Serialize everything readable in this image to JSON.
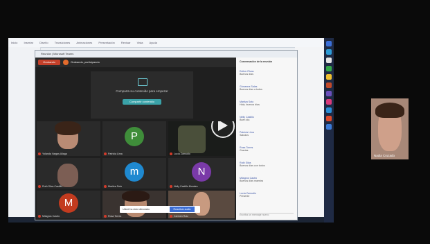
{
  "screen": {
    "browser_tabs": [
      "Inicio",
      "Insertar",
      "Diseño",
      "Transiciones",
      "Animaciones",
      "Presentación",
      "Revisar",
      "Vista",
      "Ayuda"
    ],
    "window_title": "Reunión | Microsoft Teams"
  },
  "meeting": {
    "record_button": "Grabando",
    "record_status": "Grabando, participando",
    "share_prompt": "Comparta su contenido para empezar",
    "share_button": "Compartir contenido",
    "participants": [
      {
        "name": "Yolanda Vargas Aliaga",
        "type": "video"
      },
      {
        "name": "Patricia Lima",
        "type": "avatar",
        "initial": "P",
        "color": "#3f8d3a"
      },
      {
        "name": "Lucía Zamudio",
        "type": "video"
      },
      {
        "name": "Ruth Silva Castillo",
        "type": "video"
      },
      {
        "name": "Maritza Soto",
        "type": "avatar",
        "initial": "m",
        "color": "#1f89d0"
      },
      {
        "name": "Nelly Castillo Morales",
        "type": "avatar",
        "initial": "N",
        "color": "#7a3aa8"
      },
      {
        "name": "Milagros Castro",
        "type": "avatar",
        "initial": "M",
        "color": "#c33b1f"
      },
      {
        "name": "Rosa Torres",
        "type": "video"
      },
      {
        "name": "Carmen Ruiz",
        "type": "video"
      }
    ],
    "toast_text": "Usted ha sido silenciado",
    "toast_button": "Reactivar audio"
  },
  "chat": {
    "title": "Conversación de la reunión",
    "messages": [
      {
        "who": "Esther Rivas",
        "text": "Buenos días"
      },
      {
        "who": "Giovanna Salas",
        "text": "Buenos días a todos"
      },
      {
        "who": "Maritza Soto",
        "text": "Hola, buenos días"
      },
      {
        "who": "Nelly Castillo",
        "text": "Buen día"
      },
      {
        "who": "Patricia Lima",
        "text": "Saludos"
      },
      {
        "who": "Rosa Torres",
        "text": "Gracias"
      },
      {
        "who": "Ruth Silva",
        "text": "Buenos días con todos"
      },
      {
        "who": "Milagros Castro",
        "text": "Buenos días maestra"
      },
      {
        "who": "Lucía Zamudio",
        "text": "Presente"
      }
    ],
    "input_placeholder": "Escriba un mensaje nuevo"
  },
  "presenter": {
    "name": "Nadia Cruzado"
  },
  "colors": {
    "record_red": "#c4402a",
    "teams_accent": "#3aa2a8",
    "background": "#0a0a0a"
  }
}
